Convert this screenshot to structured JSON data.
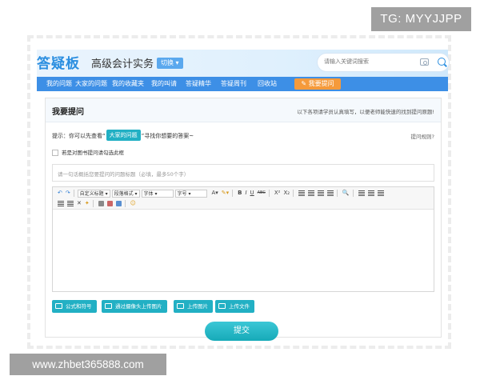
{
  "watermark": {
    "tg": "TG: MYYJJPP",
    "url": "www.zhbet365888.com"
  },
  "header": {
    "logo": "答疑板",
    "subject": "高级会计实务",
    "switch_label": "切换",
    "search_placeholder": "请输入关键词搜索"
  },
  "nav": {
    "items": [
      "我的问题",
      "大家的问题",
      "我的收藏夹",
      "我的叫请",
      "答疑精华",
      "答疑周刊",
      "回收站"
    ],
    "ask_button": "我要提问"
  },
  "panel": {
    "title": "我要提问",
    "note": "以下各项请学员认真填写，以便老师能快速的找到提问原题!",
    "tip_prefix": "提示：你可以先查看“",
    "tip_link": "大家的问题",
    "tip_suffix": "”寻找你想要的答案~",
    "help_link": "提问规则?",
    "checkbox_label": "若是对图书提问请勾选此框",
    "summary_placeholder": "请一句话概括您要提问的问题标题（必填，最多50个字）"
  },
  "toolbar": {
    "custom_title": "自定义标题",
    "paragraph": "段落格式",
    "font": "字体",
    "size": "字号",
    "font_color": "A",
    "bold": "B",
    "italic": "I",
    "underline": "U",
    "strike": "ABC",
    "sup": "X²",
    "sub": "X₂"
  },
  "uploads": [
    "公式和符号",
    "通过摄像头上传图片",
    "上传图片",
    "上传文件"
  ],
  "submit": "提交"
}
